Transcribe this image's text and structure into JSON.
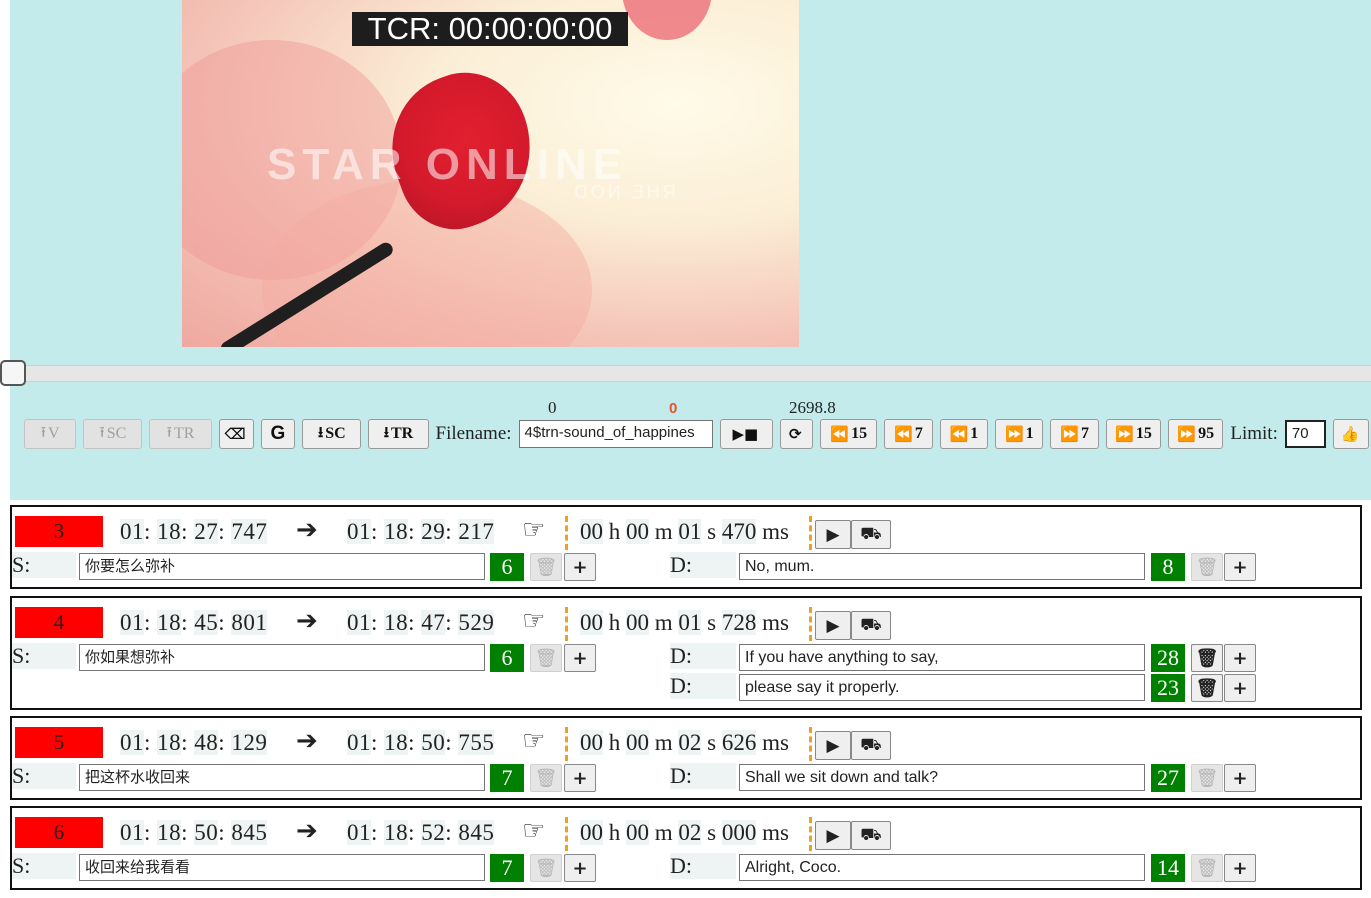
{
  "video": {
    "tcr": "TCR: 00:00:00:00",
    "watermark": "STAR ONLINE",
    "watermark_sub": "ᗡОИ ƎНЯ"
  },
  "positions": {
    "start": "0",
    "current": "0",
    "end": "2698.8"
  },
  "toolbar": {
    "upload_v": "V",
    "upload_sc": "SC",
    "upload_tr": "TR",
    "eraser_icon": "eraser",
    "g_label": "G",
    "download_sc": "SC",
    "download_tr": "TR",
    "filename_label": "Filename:",
    "filename_value": "4$trn-sound_of_happines",
    "play_stop": "▶■",
    "refresh": "⟳",
    "back15": "15",
    "back7": "7",
    "back1": "1",
    "fwd1": "1",
    "fwd7": "7",
    "fwd15": "15",
    "fwd95": "95",
    "limit_label": "Limit:",
    "limit_value": "70",
    "like_icon": "thumbs-up"
  },
  "rows": [
    {
      "id": "3",
      "start": [
        "01",
        "18",
        "27",
        "747"
      ],
      "end": [
        "01",
        "18",
        "29",
        "217"
      ],
      "dur": [
        "00",
        "00",
        "01",
        "470"
      ],
      "s_label": "S:",
      "s_text": "你要怎么弥补",
      "s_count": "6",
      "d_label": "D:",
      "d_lines": [
        {
          "text": "No, mum.",
          "count": "8"
        }
      ]
    },
    {
      "id": "4",
      "start": [
        "01",
        "18",
        "45",
        "801"
      ],
      "end": [
        "01",
        "18",
        "47",
        "529"
      ],
      "dur": [
        "00",
        "00",
        "01",
        "728"
      ],
      "s_label": "S:",
      "s_text": "你如果想弥补",
      "s_count": "6",
      "d_label": "D:",
      "d_lines": [
        {
          "text": "If you have anything to say,",
          "count": "28"
        },
        {
          "text": "please say it properly.",
          "count": "23"
        }
      ]
    },
    {
      "id": "5",
      "start": [
        "01",
        "18",
        "48",
        "129"
      ],
      "end": [
        "01",
        "18",
        "50",
        "755"
      ],
      "dur": [
        "00",
        "00",
        "02",
        "626"
      ],
      "s_label": "S:",
      "s_text": "把这杯水收回来",
      "s_count": "7",
      "d_label": "D:",
      "d_lines": [
        {
          "text": "Shall we sit down and talk?",
          "count": "27"
        }
      ]
    },
    {
      "id": "6",
      "start": [
        "01",
        "18",
        "50",
        "845"
      ],
      "end": [
        "01",
        "18",
        "52",
        "845"
      ],
      "dur": [
        "00",
        "00",
        "02",
        "000"
      ],
      "s_label": "S:",
      "s_text": "收回来给我看看",
      "s_count": "7",
      "d_label": "D:",
      "d_lines": [
        {
          "text": "Alright, Coco.",
          "count": "14"
        }
      ]
    }
  ],
  "units": {
    "h": "h",
    "m": "m",
    "s": "s",
    "ms": "ms"
  },
  "colors": {
    "panel": "#c4ebeb",
    "id_bg": "#ff0000",
    "count_bg": "#008000",
    "dash": "#f0a020",
    "current_pos": "#e8532a"
  }
}
